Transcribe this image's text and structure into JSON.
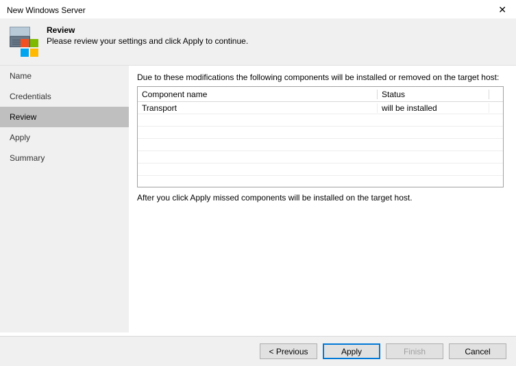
{
  "window": {
    "title": "New Windows Server"
  },
  "header": {
    "title": "Review",
    "subtitle": "Please review your settings and click Apply to continue."
  },
  "sidebar": {
    "items": [
      {
        "label": "Name",
        "active": false
      },
      {
        "label": "Credentials",
        "active": false
      },
      {
        "label": "Review",
        "active": true
      },
      {
        "label": "Apply",
        "active": false
      },
      {
        "label": "Summary",
        "active": false
      }
    ]
  },
  "main": {
    "intro": "Due to these modifications the following components will be installed or removed on the target host:",
    "columns": {
      "name": "Component name",
      "status": "Status"
    },
    "rows": [
      {
        "name": "Transport",
        "status": "will be installed"
      }
    ],
    "after": "After you click Apply missed components will be installed on the target host."
  },
  "footer": {
    "previous": "< Previous",
    "apply": "Apply",
    "finish": "Finish",
    "cancel": "Cancel"
  }
}
